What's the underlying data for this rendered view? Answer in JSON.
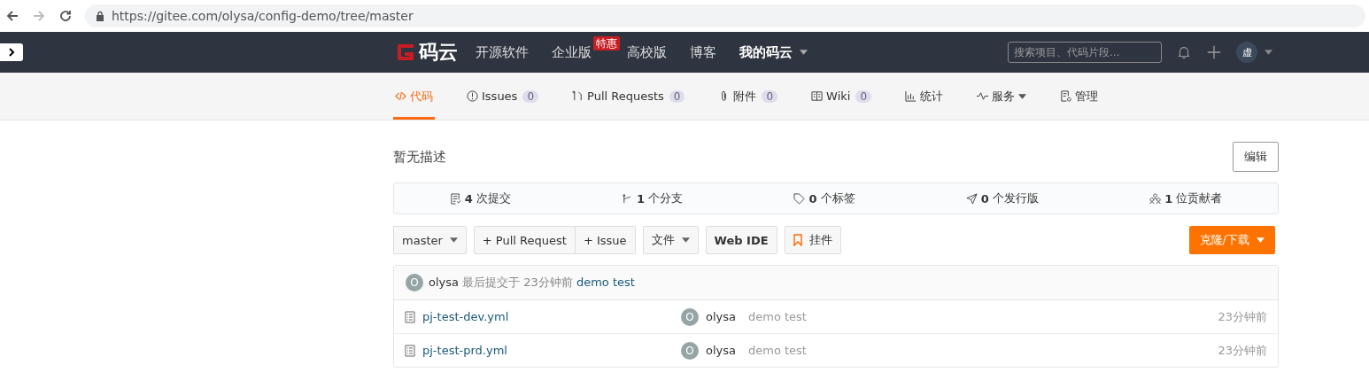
{
  "browser": {
    "url": "https://gitee.com/olysa/config-demo/tree/master"
  },
  "nav": {
    "logo": "码云",
    "links": [
      {
        "label": "开源软件",
        "bold": false,
        "dropdown": false
      },
      {
        "label": "企业版",
        "badge": "特惠",
        "bold": false,
        "dropdown": false
      },
      {
        "label": "高校版",
        "bold": false,
        "dropdown": false
      },
      {
        "label": "博客",
        "bold": false,
        "dropdown": false
      },
      {
        "label": "我的码云",
        "bold": true,
        "dropdown": true
      }
    ],
    "search": {
      "placeholder": "搜索项目、代码片段..."
    },
    "avatar": "虚"
  },
  "tabs": [
    {
      "kind": "code",
      "label": "代码",
      "selected": true
    },
    {
      "kind": "issue",
      "label": "Issues",
      "count": "0",
      "selected": false
    },
    {
      "kind": "pr",
      "label": "Pull Requests",
      "count": "0",
      "selected": false
    },
    {
      "kind": "attach",
      "label": "附件",
      "count": "0",
      "selected": false
    },
    {
      "kind": "wiki",
      "label": "Wiki",
      "count": "0",
      "selected": false
    },
    {
      "kind": "stats",
      "label": "统计",
      "selected": false
    },
    {
      "kind": "service",
      "label": "服务",
      "dropdown": true,
      "selected": false
    },
    {
      "kind": "manage",
      "label": "管理",
      "selected": false
    }
  ],
  "description": "暂无描述",
  "edit_button": "编辑",
  "stats": [
    {
      "kind": "commit",
      "count": "4",
      "label": "次提交"
    },
    {
      "kind": "branch",
      "count": "1",
      "label": "个分支"
    },
    {
      "kind": "tag",
      "count": "0",
      "label": "个标签"
    },
    {
      "kind": "release",
      "count": "0",
      "label": "个发行版"
    },
    {
      "kind": "people",
      "count": "1",
      "label": "位贡献者"
    }
  ],
  "toolbar": {
    "branch": "master",
    "pull_request": "+ Pull Request",
    "issue": "+ Issue",
    "file": "文件",
    "web_ide": "Web IDE",
    "widget": "挂件",
    "clone": "克隆/下载"
  },
  "last_commit": {
    "avatar": "O",
    "author": "olysa",
    "text": "最后提交于",
    "time": "23分钟前",
    "message": "demo test"
  },
  "files": [
    {
      "name": "pj-test-dev.yml",
      "avatar": "O",
      "author": "olysa",
      "message": "demo test",
      "time": "23分钟前"
    },
    {
      "name": "pj-test-prd.yml",
      "avatar": "O",
      "author": "olysa",
      "message": "demo test",
      "time": "23分钟前"
    }
  ]
}
